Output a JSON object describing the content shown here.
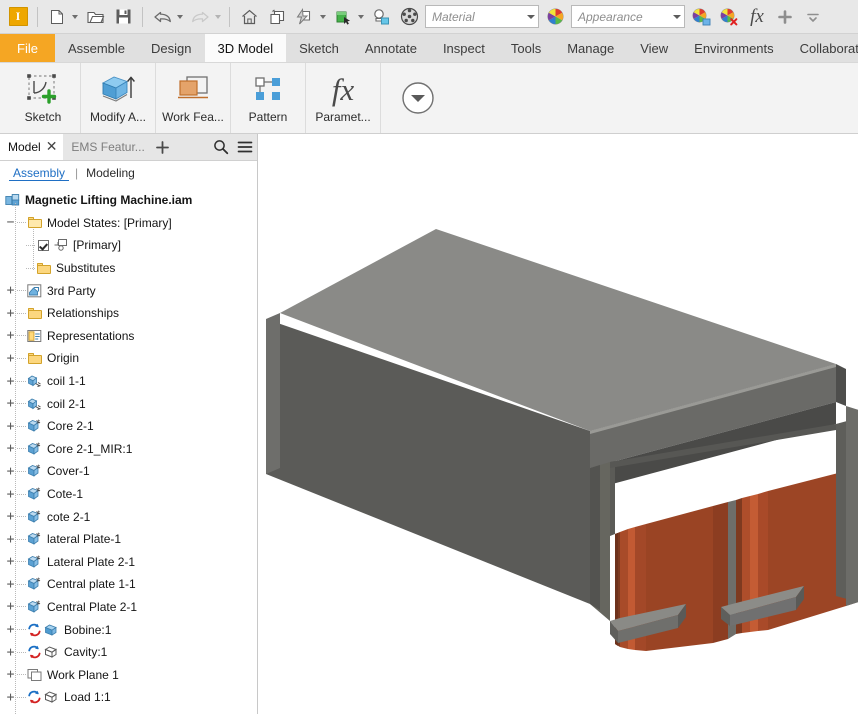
{
  "window": {
    "application": "Autodesk Inventor",
    "document_title": "Magnetic Lifting Machine.iam"
  },
  "quick_access": {
    "logo": "inventor-logo",
    "items": [
      {
        "name": "new-file",
        "icon": "new-document-icon",
        "dropdown": true
      },
      {
        "name": "open-file",
        "icon": "open-folder-icon",
        "dropdown": false
      },
      {
        "name": "save-file",
        "icon": "floppy-disk-icon",
        "dropdown": false
      },
      {
        "name": "undo",
        "icon": "undo-arrow-icon",
        "dropdown": true
      },
      {
        "name": "redo",
        "icon": "redo-arrow-icon",
        "dropdown": true,
        "disabled": true
      },
      {
        "name": "home",
        "icon": "home-icon",
        "dropdown": false
      },
      {
        "name": "return",
        "icon": "return-icon",
        "dropdown": false
      },
      {
        "name": "update",
        "icon": "update-lightning-icon",
        "dropdown": true
      },
      {
        "name": "select",
        "icon": "select-green-icon",
        "dropdown": true
      },
      {
        "name": "ems-analysis",
        "icon": "ems-analysis-icon",
        "dropdown": false
      },
      {
        "name": "material-sphere",
        "icon": "checker-sphere-icon",
        "dropdown": false
      }
    ],
    "material": {
      "value": "",
      "placeholder": "Material"
    },
    "appearance": {
      "value": "",
      "placeholder": "Appearance"
    },
    "right_items": [
      {
        "name": "adjust-appearance",
        "icon": "color-wheel-plus-icon"
      },
      {
        "name": "clear-appearance",
        "icon": "color-wheel-x-icon"
      },
      {
        "name": "fx-parameters",
        "icon": "fx-icon"
      },
      {
        "name": "add-tool",
        "icon": "plus-icon"
      },
      {
        "name": "more-tools",
        "icon": "chevron-down-icon"
      }
    ]
  },
  "ribbon": {
    "tabs": [
      {
        "label": "File",
        "active": false,
        "file": true
      },
      {
        "label": "Assemble",
        "active": false
      },
      {
        "label": "Design",
        "active": false
      },
      {
        "label": "3D Model",
        "active": true
      },
      {
        "label": "Sketch",
        "active": false
      },
      {
        "label": "Annotate",
        "active": false
      },
      {
        "label": "Inspect",
        "active": false
      },
      {
        "label": "Tools",
        "active": false
      },
      {
        "label": "Manage",
        "active": false
      },
      {
        "label": "View",
        "active": false
      },
      {
        "label": "Environments",
        "active": false
      },
      {
        "label": "Collaborate",
        "active": false
      }
    ],
    "panels": [
      {
        "label": "Sketch",
        "icon": "create-sketch-icon"
      },
      {
        "label": "Modify A...",
        "icon": "modify-assembly-icon"
      },
      {
        "label": "Work Fea...",
        "icon": "work-features-icon"
      },
      {
        "label": "Pattern",
        "icon": "pattern-icon"
      },
      {
        "label": "Paramet...",
        "icon": "fx-parameters-icon"
      },
      {
        "label": "",
        "icon": "panel-expand-down-icon"
      }
    ]
  },
  "browser": {
    "tabs": [
      {
        "label": "Model",
        "selected": true,
        "closable": true
      },
      {
        "label": "EMS Featur...",
        "selected": false,
        "closable": false
      }
    ],
    "tab_actions": [
      {
        "name": "add-tab-button",
        "icon": "plus-icon"
      },
      {
        "name": "search-browser-button",
        "icon": "search-icon"
      },
      {
        "name": "browser-menu-button",
        "icon": "hamburger-menu-icon"
      }
    ],
    "subtabs": [
      {
        "label": "Assembly",
        "active": true
      },
      {
        "label": "Modeling",
        "active": false
      }
    ],
    "tree": [
      {
        "label": "Magnetic Lifting Machine.iam",
        "depth": 0,
        "expander": "",
        "icon": "assembly-icon",
        "bold": true
      },
      {
        "label": "Model States: [Primary]",
        "depth": 1,
        "expander": "−",
        "icon": "folder-open-icon",
        "bold": false
      },
      {
        "label": "[Primary]",
        "depth": 2,
        "expander": "",
        "icon": "checkbox-model-state-icon",
        "bold": false
      },
      {
        "label": "Substitutes",
        "depth": 2,
        "expander": "",
        "icon": "folder-icon",
        "bold": false
      },
      {
        "label": "3rd Party",
        "depth": 1,
        "expander": "+",
        "icon": "third-party-icon",
        "bold": false
      },
      {
        "label": "Relationships",
        "depth": 1,
        "expander": "+",
        "icon": "folder-icon",
        "bold": false
      },
      {
        "label": "Representations",
        "depth": 1,
        "expander": "+",
        "icon": "representations-icon",
        "bold": false
      },
      {
        "label": "Origin",
        "depth": 1,
        "expander": "+",
        "icon": "folder-icon",
        "bold": false
      },
      {
        "label": "coil 1-1",
        "depth": 1,
        "expander": "+",
        "icon": "subassembly-icon",
        "bold": false
      },
      {
        "label": "coil 2-1",
        "depth": 1,
        "expander": "+",
        "icon": "subassembly-icon",
        "bold": false
      },
      {
        "label": "Core 2-1",
        "depth": 1,
        "expander": "+",
        "icon": "part-icon",
        "bold": false
      },
      {
        "label": "Core 2-1_MIR:1",
        "depth": 1,
        "expander": "+",
        "icon": "part-icon",
        "bold": false
      },
      {
        "label": "Cover-1",
        "depth": 1,
        "expander": "+",
        "icon": "part-icon",
        "bold": false
      },
      {
        "label": "Cote-1",
        "depth": 1,
        "expander": "+",
        "icon": "part-icon",
        "bold": false
      },
      {
        "label": "cote 2-1",
        "depth": 1,
        "expander": "+",
        "icon": "part-icon",
        "bold": false
      },
      {
        "label": "lateral Plate-1",
        "depth": 1,
        "expander": "+",
        "icon": "part-icon",
        "bold": false
      },
      {
        "label": "Lateral Plate 2-1",
        "depth": 1,
        "expander": "+",
        "icon": "part-icon",
        "bold": false
      },
      {
        "label": "Central plate 1-1",
        "depth": 1,
        "expander": "+",
        "icon": "part-icon",
        "bold": false
      },
      {
        "label": "Central Plate 2-1",
        "depth": 1,
        "expander": "+",
        "icon": "part-icon",
        "bold": false
      },
      {
        "label": "Bobine:1",
        "depth": 1,
        "expander": "+",
        "icon": "ems-solid-body-icon",
        "bold": false
      },
      {
        "label": "Cavity:1",
        "depth": 1,
        "expander": "+",
        "icon": "ems-wire-body-icon",
        "bold": false
      },
      {
        "label": "Work Plane 1",
        "depth": 1,
        "expander": "+",
        "icon": "work-plane-icon",
        "bold": false
      },
      {
        "label": "Load 1:1",
        "depth": 1,
        "expander": "+",
        "icon": "ems-wire-body-icon",
        "bold": false
      }
    ]
  },
  "viewport": {
    "name": "3d-model-viewport",
    "background": "#ffffff",
    "model": {
      "description": "Magnetic lifting machine assembly - grey steel housing with two copper coils visible underneath",
      "colors": {
        "housing_top": "#8a8a87",
        "housing_front": "#5b5b58",
        "housing_side": "#6e6e6b",
        "housing_dark": "#4e4e4c",
        "coil_copper": "#9e4526",
        "coil_copper_light": "#b3512c",
        "coil_copper_dark": "#7e3a20",
        "plate_grey": "#7f7f7c",
        "edge": "#3f3f3d"
      }
    }
  }
}
